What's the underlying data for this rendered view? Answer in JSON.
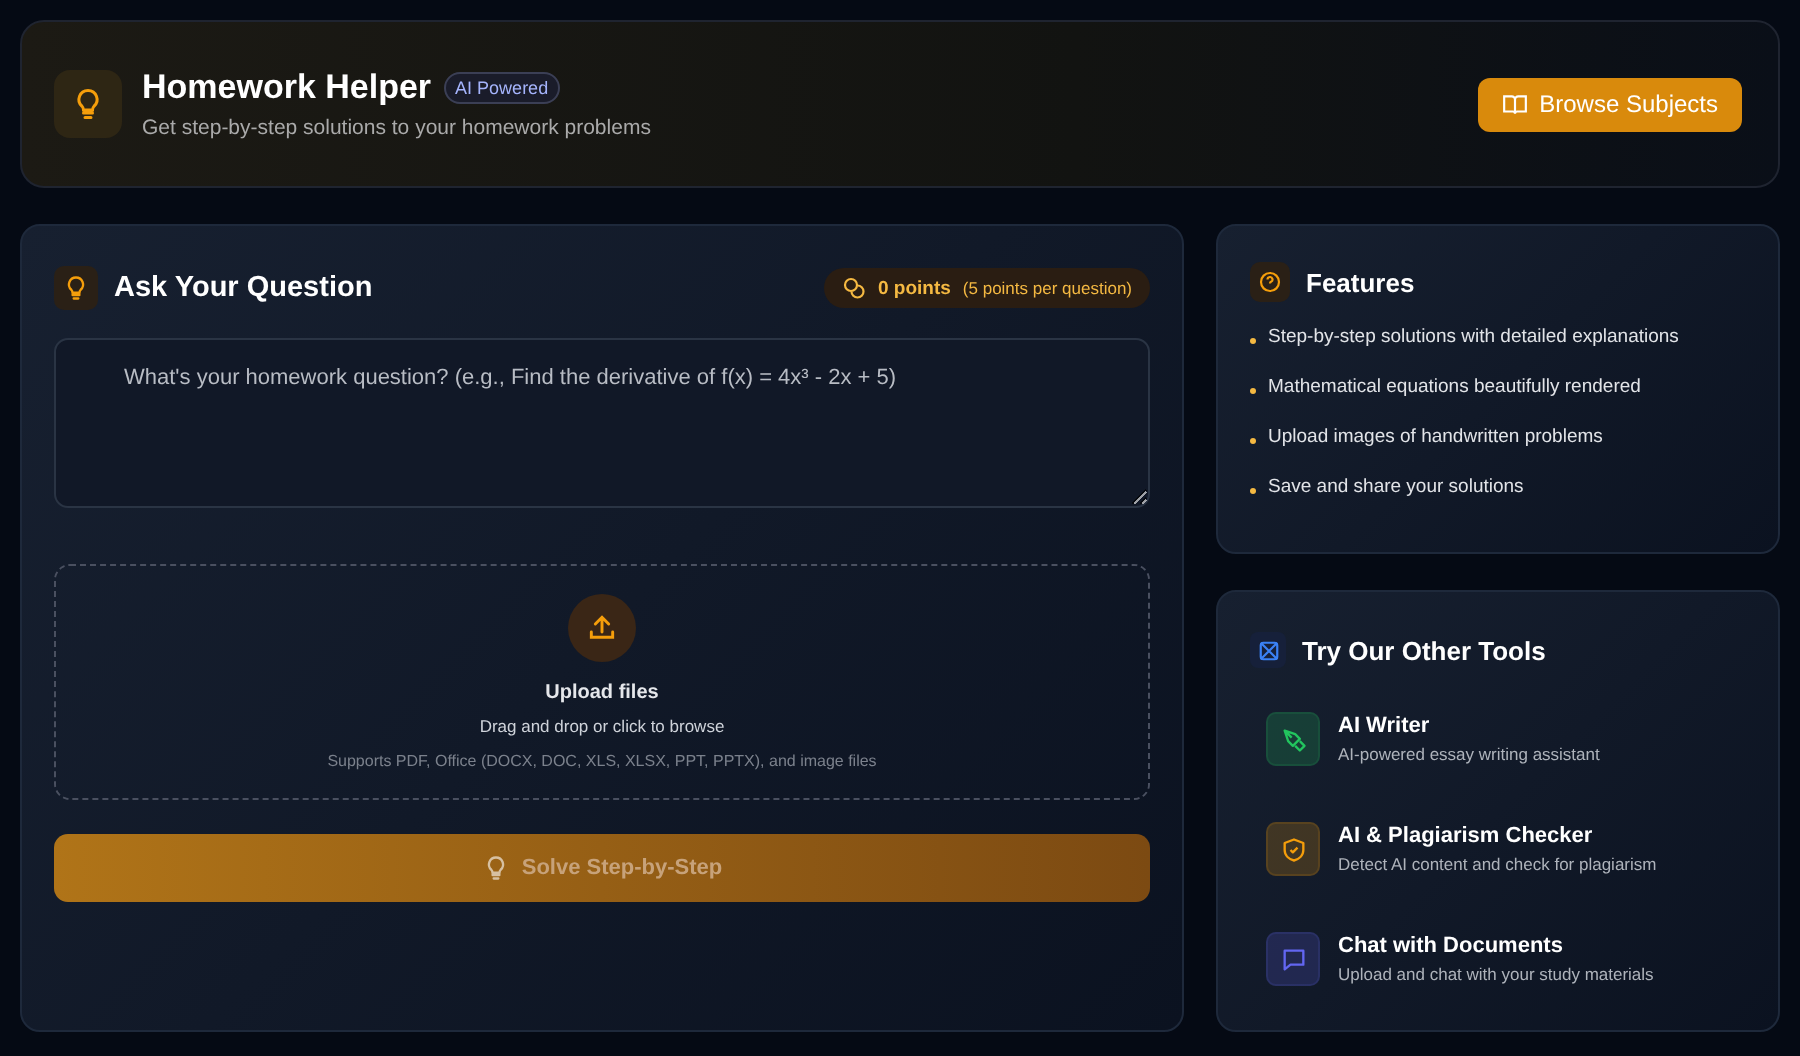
{
  "header": {
    "title": "Homework Helper",
    "badge": "AI Powered",
    "subtitle": "Get step-by-step solutions to your homework problems",
    "button": "Browse Subjects"
  },
  "ask": {
    "title": "Ask Your Question",
    "points": "0 points",
    "points_note": "(5 points per question)",
    "question": {
      "placeholder": "What's your homework question? (e.g., Find the derivative of f(x) = 4x³ - 2x + 5)"
    },
    "upload": {
      "title": "Upload files",
      "hint": "Drag and drop or click to browse",
      "formats": "Supports PDF, Office (DOCX, DOC, XLS, XLSX, PPT, PPTX), and image files"
    },
    "solve_button": {
      "label": "Solve Step-by-Step",
      "disabled": true
    }
  },
  "features": {
    "title": "Features",
    "items": [
      "Step-by-step solutions with detailed explanations",
      "Mathematical equations beautifully rendered",
      "Upload images of handwritten problems",
      "Save and share your solutions"
    ]
  },
  "tools": {
    "title": "Try Our Other Tools",
    "items": [
      {
        "kind": "writer",
        "name": "AI Writer",
        "description": "AI-powered essay writing assistant",
        "color": "#22c55e"
      },
      {
        "kind": "checker",
        "name": "AI & Plagiarism Checker",
        "description": "Detect AI content and check for plagiarism",
        "color": "#f59e0b"
      },
      {
        "kind": "chat",
        "name": "Chat with Documents",
        "description": "Upload and chat with your study materials",
        "color": "#6366f1"
      }
    ]
  }
}
